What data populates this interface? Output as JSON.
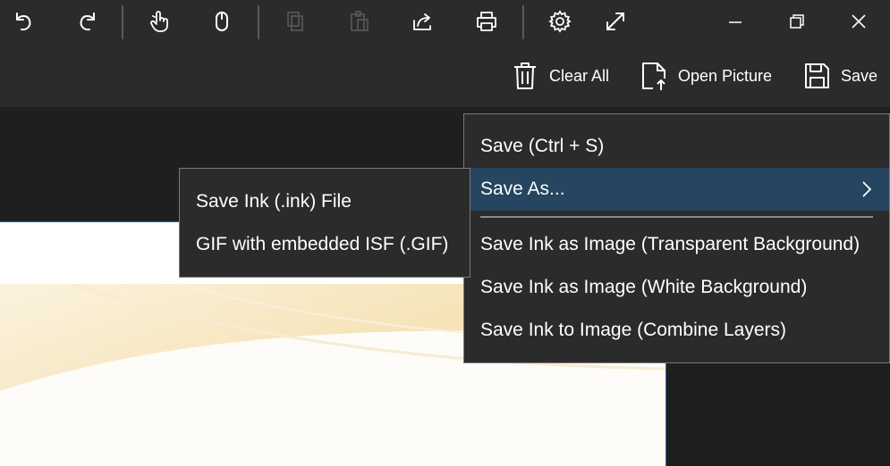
{
  "toolbar": {
    "icons": [
      "undo-icon",
      "redo-icon",
      "touch-icon",
      "mouse-icon",
      "copy-icon",
      "paste-icon",
      "share-icon",
      "print-icon",
      "settings-icon",
      "fullscreen-icon",
      "minimize-icon",
      "restore-icon",
      "close-icon"
    ]
  },
  "commands": {
    "clear_all": "Clear All",
    "open_picture": "Open Picture",
    "save": "Save"
  },
  "save_menu": {
    "save": "Save (Ctrl + S)",
    "save_as": "Save As...",
    "transparent": "Save Ink as Image (Transparent Background)",
    "white": "Save Ink as Image (White Background)",
    "combine": "Save Ink to Image (Combine Layers)"
  },
  "save_as_submenu": {
    "ink_file": "Save Ink (.ink) File",
    "gif": "GIF with embedded ISF (.GIF)"
  },
  "colors": {
    "toolbar_bg": "#2b2b2b",
    "menu_highlight": "#254560",
    "canvas_border": "#2d6ea6"
  }
}
